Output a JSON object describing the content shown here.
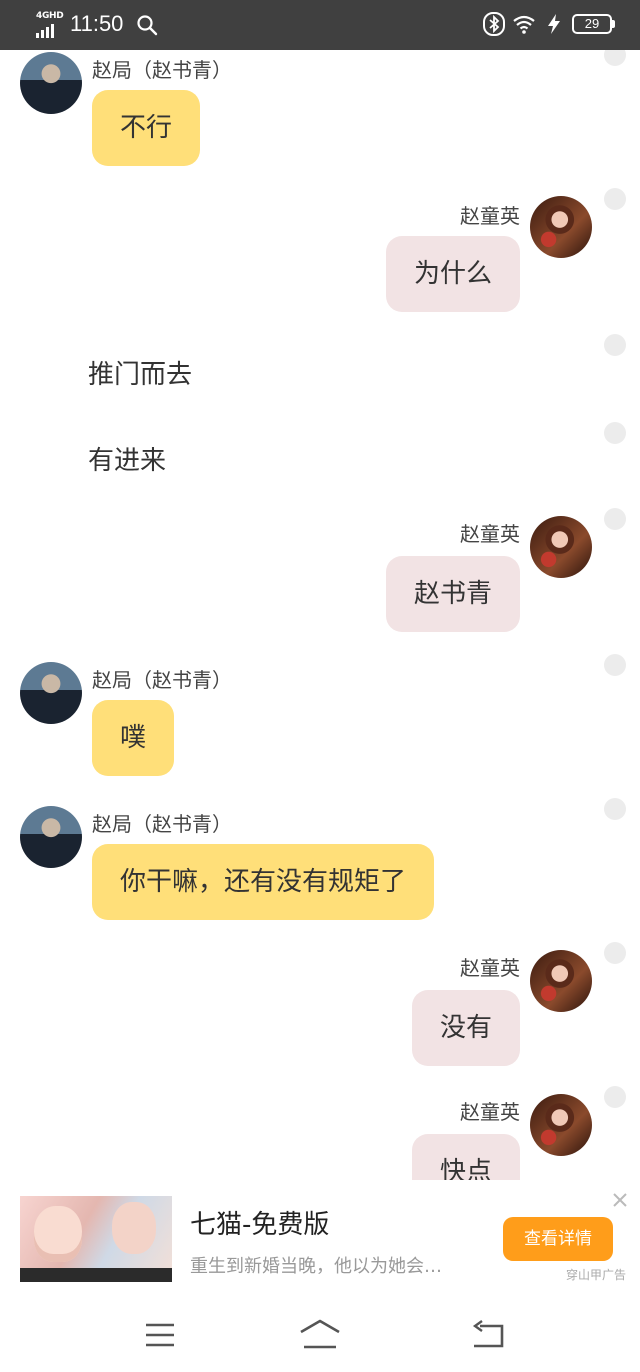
{
  "status_bar": {
    "network": "4GHD",
    "time": "11:50",
    "battery": "29"
  },
  "messages": [
    {
      "type": "left",
      "sender": "赵局（赵书青）",
      "text": "不行"
    },
    {
      "type": "right",
      "sender": "赵童英",
      "text": "为什么"
    },
    {
      "type": "narration",
      "text": "推门而去"
    },
    {
      "type": "narration",
      "text": "有进来"
    },
    {
      "type": "right",
      "sender": "赵童英",
      "text": "赵书青"
    },
    {
      "type": "left",
      "sender": "赵局（赵书青）",
      "text": "噗"
    },
    {
      "type": "left",
      "sender": "赵局（赵书青）",
      "text": "你干嘛，还有没有规矩了"
    },
    {
      "type": "right",
      "sender": "赵童英",
      "text": "没有"
    },
    {
      "type": "right",
      "sender": "赵童英",
      "text": "快点"
    }
  ],
  "ad": {
    "title": "七猫-免费版",
    "description": "重生到新婚当晚，他以为她会…",
    "button_label": "查看详情",
    "source_label": "穿山甲广告"
  },
  "colors": {
    "left_bubble": "#ffdf79",
    "right_bubble": "#f2e3e4",
    "ad_button": "#ff9d1a",
    "status_bar": "#404040"
  }
}
